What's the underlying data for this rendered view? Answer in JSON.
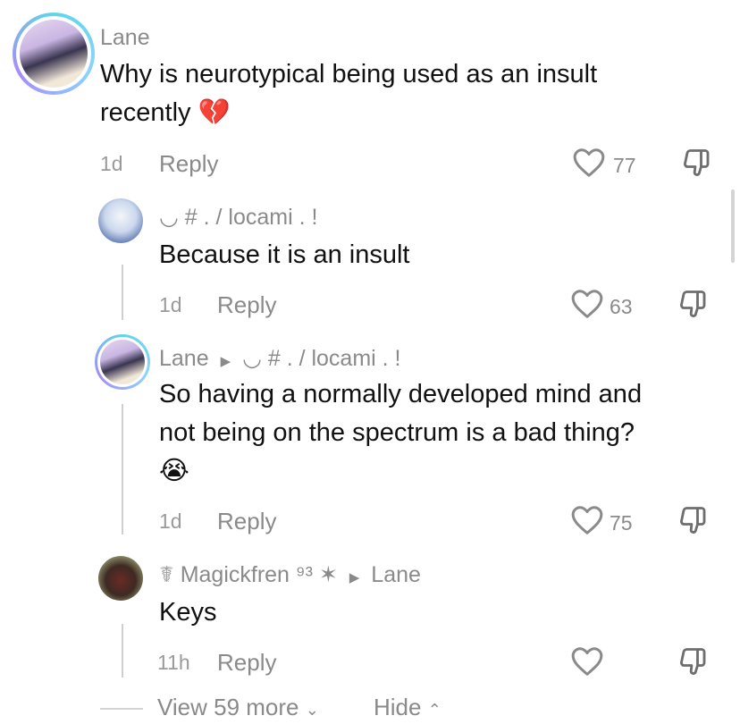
{
  "comments": [
    {
      "username": "Lane",
      "text_line1": "Why is neurotypical being used as an insult",
      "text_line2": "recently",
      "emoji": "💔",
      "time": "1d",
      "reply_label": "Reply",
      "likes": "77"
    },
    {
      "username": "◡ # . / locami . !",
      "text": "Because it is an insult",
      "time": "1d",
      "reply_label": "Reply",
      "likes": "63"
    },
    {
      "username": "Lane",
      "reply_to": "◡ # . / locami . !",
      "text_line1": "So having a normally developed mind and",
      "text_line2": "not being on the spectrum is a bad thing?",
      "emoji": "😭",
      "time": "1d",
      "reply_label": "Reply",
      "likes": "75"
    },
    {
      "username_prefix": "☤",
      "username": "Magickfren",
      "username_suffix": "⁹³ ✶",
      "reply_to": "Lane",
      "text": "Keys",
      "time": "11h",
      "reply_label": "Reply",
      "likes": ""
    }
  ],
  "footer": {
    "view_more": "View 59 more",
    "hide": "Hide"
  },
  "icons": {
    "like": "heart-outline-icon",
    "dislike": "thumbs-down-outline-icon",
    "reply_arrow": "triangle-right-icon"
  }
}
